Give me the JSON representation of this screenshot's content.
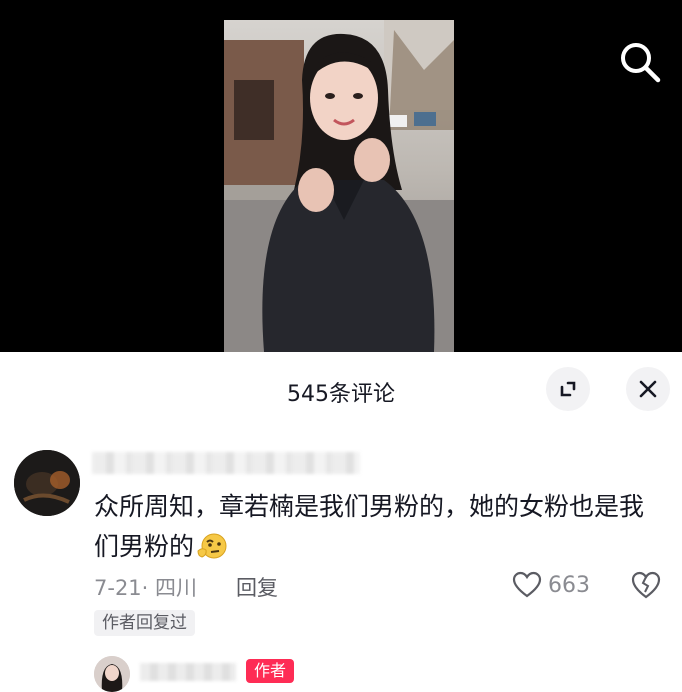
{
  "video": {
    "search_icon": "search-icon"
  },
  "comments_panel": {
    "count_label": "545条评论",
    "expand_icon": "expand-icon",
    "close_icon": "close-icon"
  },
  "comment": {
    "text": "众所周知，章若楠是我们男粉的，她的女粉也是我们男粉的",
    "emoji": "thinking-face-emoji",
    "date_location": "7-21· 四川",
    "reply_label": "回复",
    "like_count": "663",
    "author_replied_label": "作者回复过"
  },
  "reply": {
    "author_badge": "作者"
  },
  "colors": {
    "video_background": "#000000",
    "text_primary": "#161823",
    "text_secondary": "#8a8b91",
    "accent": "#fe2c55"
  }
}
